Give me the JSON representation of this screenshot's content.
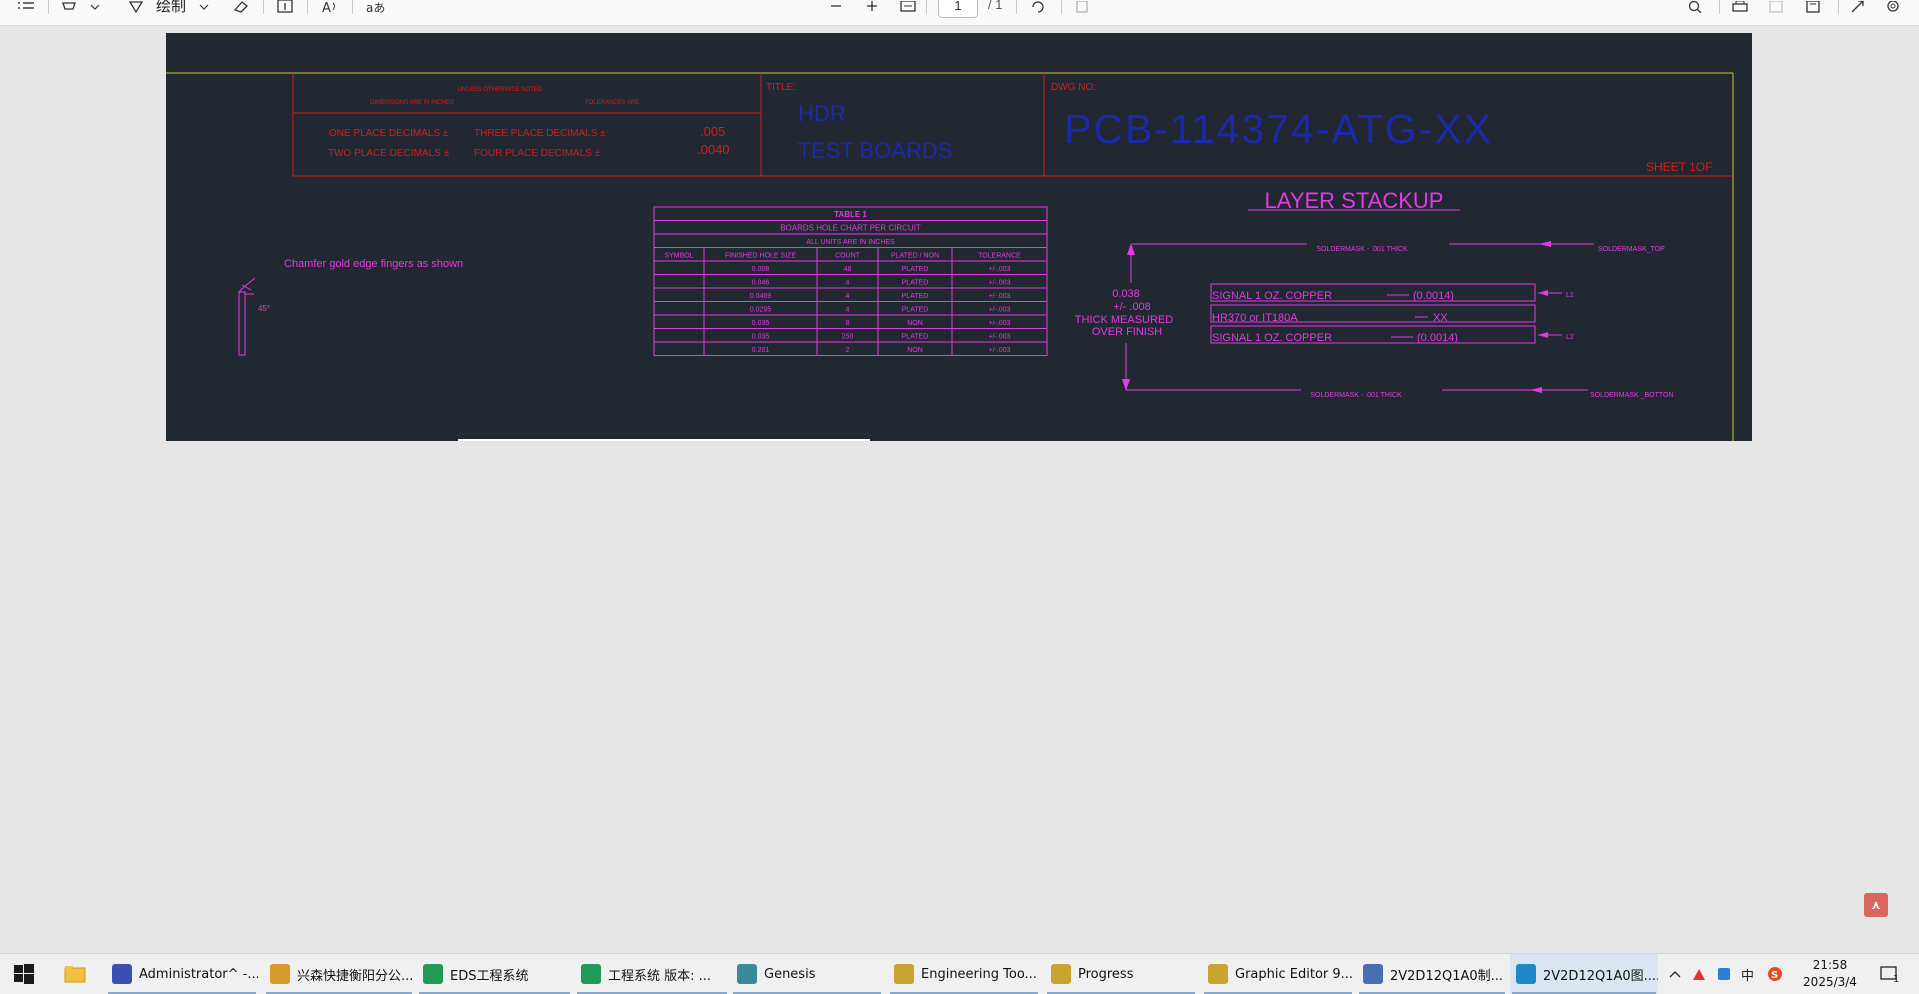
{
  "toolbar": {
    "draw_label": "绘制",
    "page_current": "1",
    "page_total": "/ 1",
    "icons": [
      "list-icon",
      "highlight-icon",
      "chevron-down-icon",
      "draw-icon",
      "chevron-down-icon",
      "eraser-icon",
      "text-box-icon",
      "read-aloud-icon",
      "translate-icon",
      "zoom-out-icon",
      "zoom-in-icon",
      "fit-page-icon",
      "rotate-icon",
      "page-view-icon",
      "search-icon",
      "print-icon",
      "save-icon",
      "save-as-icon",
      "fullscreen-icon",
      "settings-icon"
    ]
  },
  "drawing": {
    "tolerance_block": {
      "unless_noted": "UNLESS OTHERWISE NOTED",
      "dimensions_in": "DIMENSIONS ARE IN INCHES",
      "tolerances_are": "TOLERANCES ARE:",
      "one_place": "ONE PLACE DECIMALS ±",
      "two_place": "TWO PLACE DECIMALS ±",
      "three_place": "THREE PLACE DECIMALS ±",
      "four_place": "FOUR PLACE DECIMALS ±",
      "three_value": ".005",
      "four_value": ".0040"
    },
    "title_block": {
      "title_label": "TITLE:",
      "title_line1": "HDR",
      "title_line2": "TEST BOARDS",
      "dwg_label": "DWG NO:",
      "dwg_number": "PCB-114374-ATG-XX",
      "sheet": "SHEET 1OF"
    },
    "chamfer_note": "Chamfer gold edge fingers as shown",
    "chamfer_angle": "45°",
    "table": {
      "title": "TABLE 1",
      "subtitle": "BOARDS HOLE CHART PER CIRCUIT",
      "units": "ALL UNITS ARE IN INCHES",
      "headers": [
        "SYMBOL",
        "FINISHED HOLE SIZE",
        "COUNT",
        "PLATED / NON",
        "TOLERANCE"
      ],
      "rows": [
        [
          "",
          "0.008",
          "48",
          "PLATED",
          "+/-.003"
        ],
        [
          "",
          "0.046",
          "4",
          "PLATED",
          "+/-.003"
        ],
        [
          "",
          "0.0469",
          "4",
          "PLATED",
          "+/-.003"
        ],
        [
          "",
          "0.0295",
          "4",
          "PLATED",
          "+/-.003"
        ],
        [
          "",
          "0.035",
          "8",
          "NON",
          "+/-.003"
        ],
        [
          "",
          "0.035",
          "250",
          "PLATED",
          "+/-.003"
        ],
        [
          "",
          "0.201",
          "2",
          "NON",
          "+/-.003"
        ]
      ]
    },
    "stackup": {
      "title": "LAYER STACKUP",
      "mask_top": "SOLDERMASK - .001 THICK",
      "mask_top_label": "SOLDERMASK_TOP",
      "mask_bottom": "SOLDERMASK - .001 THICK",
      "mask_bottom_label": "SOLDERMASK _BOTTON",
      "thickness_1": "0.038",
      "thickness_2": "+/- .008",
      "thickness_3": "THICK MEASURED",
      "thickness_4": "OVER FINISH",
      "layer1": "SIGNAL 1 OZ. COPPER",
      "layer1_val": "(0.0014)",
      "layer1_tag": "L1",
      "core": "HR370 or IT180A",
      "core_val": "XX",
      "layer2": "SIGNAL 1 OZ. COPPER",
      "layer2_val": "(0.0014)",
      "layer2_tag": "L2"
    }
  },
  "taskbar": {
    "items": [
      {
        "label": "Administrator^ -...",
        "icon": "save-disk-icon",
        "color": "#3b4fb5"
      },
      {
        "label": "兴森快捷衡阳分公...",
        "icon": "shell-icon",
        "color": "#d89a2a"
      },
      {
        "label": "EDS工程系统",
        "icon": "eds-icon",
        "color": "#1f9b55"
      },
      {
        "label": "工程系统   版本: ...",
        "icon": "engineering-icon",
        "color": "#1f9b55"
      },
      {
        "label": "Genesis",
        "icon": "genesis-icon",
        "color": "#3a8a9a"
      },
      {
        "label": "Engineering Too...",
        "icon": "tool-window-icon",
        "color": "#c8a431"
      },
      {
        "label": "Progress",
        "icon": "progress-window-icon",
        "color": "#c8a431"
      },
      {
        "label": "Graphic Editor 9....",
        "icon": "graphic-editor-icon",
        "color": "#c8a431"
      },
      {
        "label": "2V2D12Q1A0制...",
        "icon": "document-icon",
        "color": "#4a6fb0"
      },
      {
        "label": "2V2D12Q1A0图....",
        "icon": "edge-browser-icon",
        "color": "#1e88c8"
      }
    ],
    "ime": "中",
    "time": "21:58",
    "date": "2025/3/4",
    "notifications": "1"
  }
}
